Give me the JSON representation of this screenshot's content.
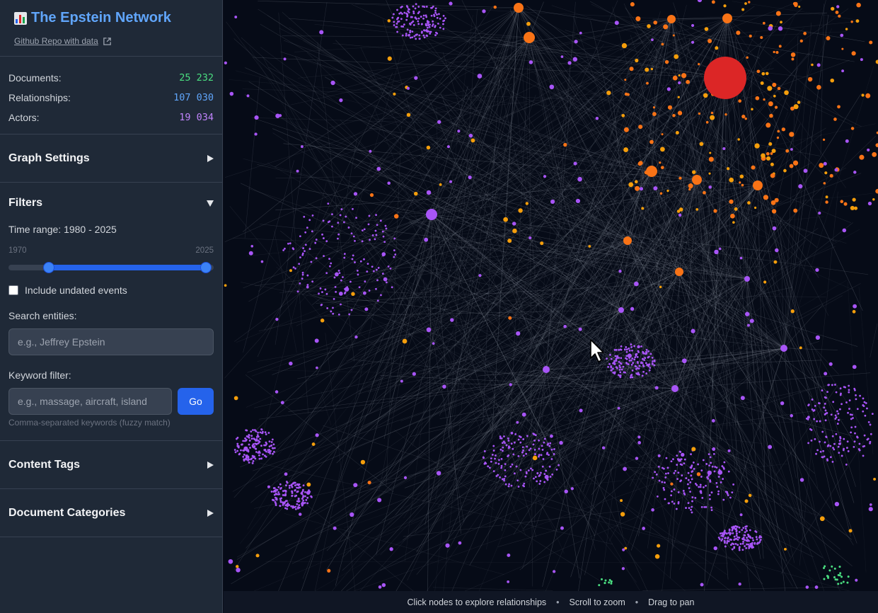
{
  "header": {
    "title": "The Epstein Network",
    "title_icon": "bar-chart-icon",
    "repo_link": "Github Repo with data",
    "repo_icon": "external-link-icon"
  },
  "stats": {
    "documents_label": "Documents:",
    "documents_value": "25 232",
    "relationships_label": "Relationships:",
    "relationships_value": "107 030",
    "actors_label": "Actors:",
    "actors_value": "19 034",
    "colors": {
      "documents": "#4ade80",
      "relationships": "#60a5fa",
      "actors": "#c084fc"
    }
  },
  "sections": {
    "graph_settings": "Graph Settings",
    "filters": "Filters",
    "content_tags": "Content Tags",
    "document_categories": "Document Categories"
  },
  "filters": {
    "time_range_label": "Time range: 1980 - 2025",
    "range_min": "1970",
    "range_max": "2025",
    "range_start": 1980,
    "range_end": 2025,
    "include_undated_label": "Include undated events",
    "include_undated_checked": false,
    "search_label": "Search entities:",
    "search_placeholder": "e.g., Jeffrey Epstein",
    "keyword_label": "Keyword filter:",
    "keyword_placeholder": "e.g., massage, aircraft, island",
    "go_label": "Go",
    "keyword_hint": "Comma-separated keywords (fuzzy match)"
  },
  "footer": {
    "hint_click": "Click nodes to explore relationships",
    "hint_zoom": "Scroll to zoom",
    "hint_pan": "Drag to pan",
    "separator": "•"
  },
  "graph": {
    "node_colors": {
      "hub": "#dc2626",
      "orange": "#f97316",
      "amber": "#f59e0b",
      "purple": "#a855f7",
      "green": "#4ade80"
    },
    "edge_color": "#9ca3af"
  }
}
